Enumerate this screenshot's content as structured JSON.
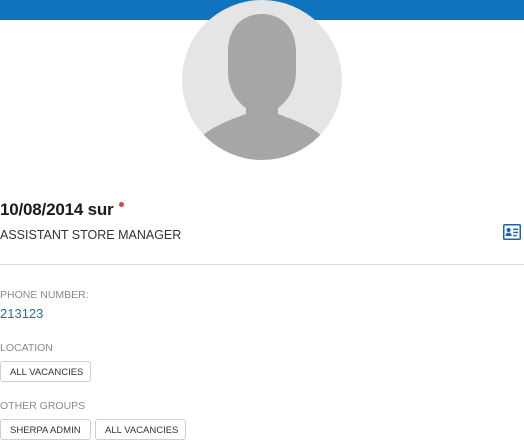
{
  "profile": {
    "name": "10/08/2014 sur",
    "job_title": "ASSISTANT STORE MANAGER",
    "status_color": "#e2404a",
    "avatar_icon": "default-user-silhouette-icon",
    "card_icon": "contact-card-icon"
  },
  "fields": {
    "phone_label": "PHONE NUMBER:",
    "phone_value": "213123",
    "location_label": "LOCATION",
    "location_tags": [
      "ALL VACANCIES"
    ],
    "groups_label": "OTHER GROUPS",
    "group_tags": [
      "SHERPA ADMIN",
      "ALL VACANCIES"
    ]
  },
  "colors": {
    "header_bar": "#0f73bf",
    "link": "#2a6aa8",
    "muted_label": "#8a8a8a"
  }
}
